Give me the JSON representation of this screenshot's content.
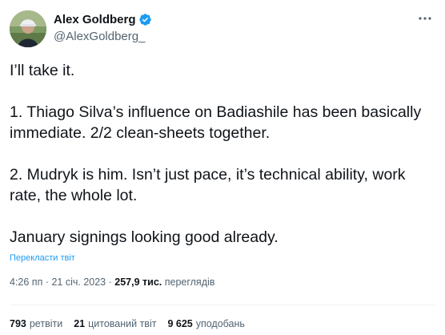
{
  "author": {
    "name": "Alex Goldberg",
    "handle": "@AlexGoldberg_",
    "verified": true
  },
  "tweet": {
    "paragraphs": [
      "I’ll take it.",
      "1. Thiago Silva’s influence on Badiashile has been basically immediate. 2/2 clean-sheets together.",
      "2. Mudryk is him. Isn’t just pace, it’s technical ability, work rate, the whole lot.",
      "January signings looking good already."
    ],
    "translate_label": "Перекласти твіт"
  },
  "meta": {
    "time": "4:26 пп",
    "date": "21 січ. 2023",
    "views_count": "257,9 тис.",
    "views_label": "переглядів",
    "separator": "·"
  },
  "stats": {
    "retweets_count": "793",
    "retweets_label": "ретвіти",
    "quotes_count": "21",
    "quotes_label": "цитований твіт",
    "likes_count": "9 625",
    "likes_label": "уподобань"
  },
  "icons": {
    "verified": "verified-badge-icon",
    "more": "more-options-icon"
  },
  "colors": {
    "accent": "#1d9bf0",
    "text": "#0f1419",
    "secondary": "#536471",
    "divider": "#eff3f4"
  }
}
